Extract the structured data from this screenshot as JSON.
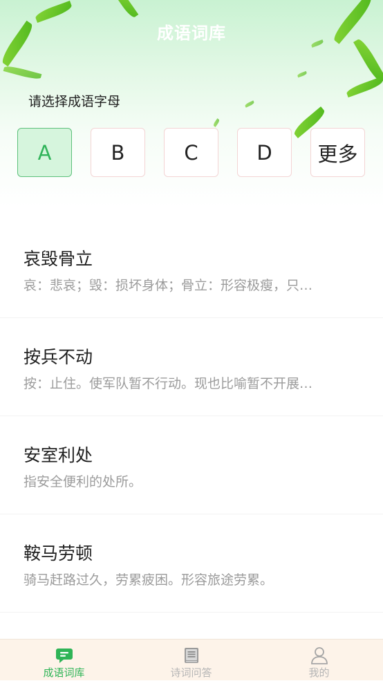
{
  "header": {
    "title": "成语词库",
    "section_label": "请选择成语字母"
  },
  "letters": [
    {
      "label": "A",
      "selected": true
    },
    {
      "label": "B",
      "selected": false
    },
    {
      "label": "C",
      "selected": false
    },
    {
      "label": "D",
      "selected": false
    },
    {
      "label": "更多",
      "selected": false
    }
  ],
  "idioms": [
    {
      "title": "哀毁骨立",
      "desc": "哀：悲哀；毁：损坏身体；骨立：形容极瘦，只…"
    },
    {
      "title": "按兵不动",
      "desc": "按：止住。使军队暂不行动。现也比喻暂不开展…"
    },
    {
      "title": "安室利处",
      "desc": "指安全便利的处所。"
    },
    {
      "title": "鞍马劳顿",
      "desc": "骑马赶路过久，劳累疲困。形容旅途劳累。"
    }
  ],
  "tabbar": {
    "tabs": [
      {
        "label": "成语词库",
        "icon": "chat-bubble-icon",
        "active": true
      },
      {
        "label": "诗词问答",
        "icon": "answer-book-icon",
        "active": false
      },
      {
        "label": "我的",
        "icon": "user-icon",
        "active": false
      }
    ]
  },
  "colors": {
    "accent": "#2fb457",
    "selected_bg": "#d6f5dd",
    "tabbar_bg": "#fdf3e9"
  }
}
